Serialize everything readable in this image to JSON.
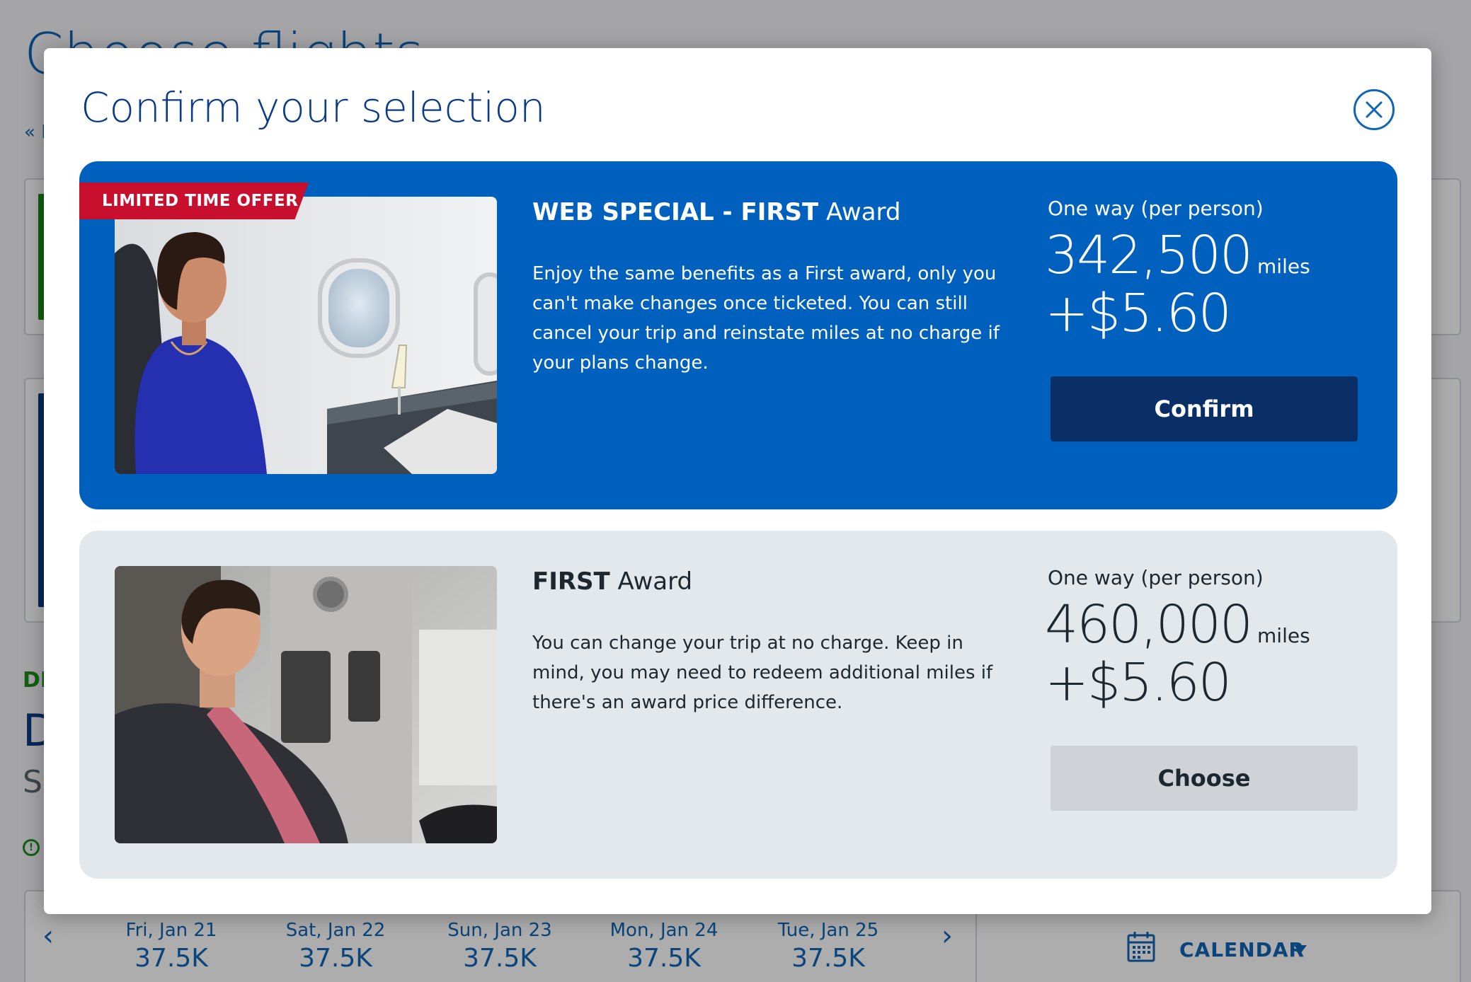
{
  "background": {
    "page_title": "Choose flights",
    "back_link": "« M",
    "depart_label": "DE",
    "city": "D",
    "day": "Su",
    "date_strip": {
      "dates": [
        {
          "day": "Fri, Jan 21",
          "price": "37.5K"
        },
        {
          "day": "Sat, Jan 22",
          "price": "37.5K"
        },
        {
          "day": "Sun, Jan 23",
          "price": "37.5K"
        },
        {
          "day": "Mon, Jan 24",
          "price": "37.5K"
        },
        {
          "day": "Tue, Jan 25",
          "price": "37.5K"
        }
      ],
      "calendar_label": "CALENDAR"
    }
  },
  "modal": {
    "title": "Confirm your selection",
    "fares": [
      {
        "badge": "LIMITED TIME OFFER",
        "name_strong": "WEB SPECIAL - FIRST",
        "name_rest": " Award",
        "description": "Enjoy the same benefits as a First award, only you can't make changes once ticketed. You can still cancel your trip and reinstate miles at no charge if your plans change.",
        "price_label": "One way (per person)",
        "miles": "342,500",
        "miles_unit": "miles",
        "fee": "+$5.60",
        "button_label": "Confirm"
      },
      {
        "name_strong": "FIRST",
        "name_rest": " Award",
        "description": "You can change your trip at no charge. Keep in mind, you may need to redeem additional miles if there's an award price difference.",
        "price_label": "One way (per person)",
        "miles": "460,000",
        "miles_unit": "miles",
        "fee": "+$5.60",
        "button_label": "Choose"
      }
    ]
  },
  "colors": {
    "brand_blue": "#0060be",
    "navy": "#0a2f66",
    "badge_red": "#c8102e",
    "first_panel_bg": "#e3e8ec"
  }
}
